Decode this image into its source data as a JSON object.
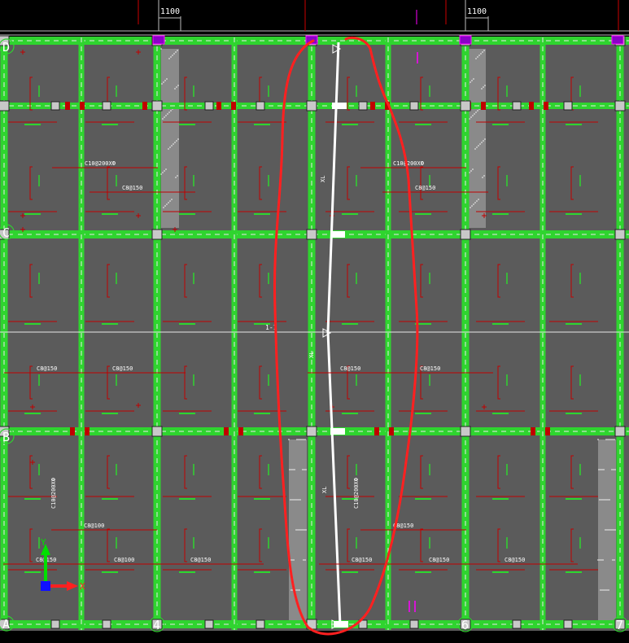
{
  "drawing": {
    "colors": {
      "background": "#000000",
      "slab": "#5b5b5b",
      "beam": "#2fd42f",
      "beam_dash": "#e8e8e8",
      "rebar": "#c00000",
      "column": "#c8c8c8",
      "text": "#ffffff",
      "highlight": "#ff2020",
      "magenta": "#ff00ff"
    },
    "dimensions": [
      "1100",
      "1100"
    ],
    "grid_rows": [
      "D",
      "C",
      "B",
      "A"
    ],
    "grid_cols": [
      "4",
      "6",
      "7"
    ],
    "slab_labels": [
      "C10@200XФ",
      "C8@150",
      "C10@200XФ",
      "C8@150",
      "C8@150",
      "C8@150",
      "C8@150",
      "C8@150",
      "C10@200XФ",
      "C10@200XФ",
      "C8@100",
      "C8@150",
      "C8@150",
      "C8@100",
      "C8@150",
      "C8@150",
      "C8@150",
      "C8@150"
    ],
    "center_marks": [
      "1-1",
      "XL",
      "XL",
      "XL"
    ],
    "axis": {
      "x": "X",
      "y": "Y"
    }
  }
}
